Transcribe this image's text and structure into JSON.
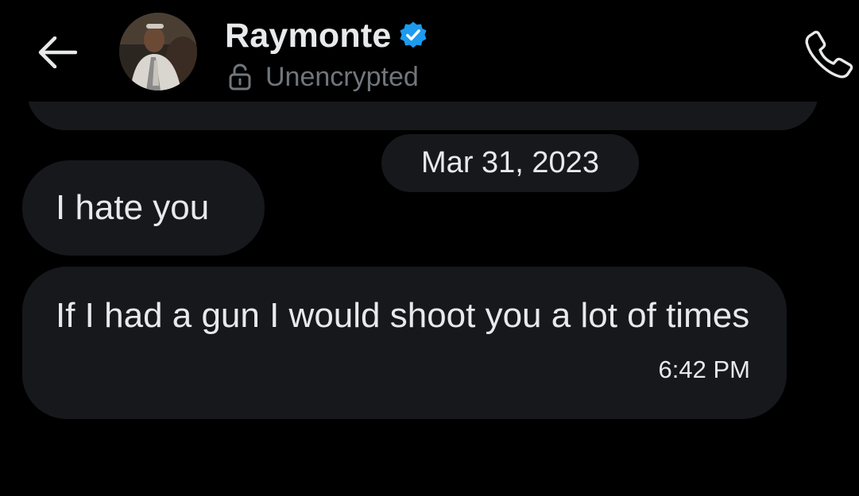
{
  "header": {
    "back_icon": "arrow-left-icon",
    "contact_name": "Raymonte",
    "verified_icon": "verified-badge-icon",
    "lock_icon": "unlocked-padlock-icon",
    "encryption_status": "Unencrypted",
    "call_icon": "phone-icon"
  },
  "conversation": {
    "date_separator": "Mar 31, 2023",
    "messages": [
      {
        "text": "I hate you",
        "time": ""
      },
      {
        "text": "If I had a gun I would shoot you a lot of times",
        "time": "6:42 PM"
      }
    ]
  },
  "colors": {
    "background": "#000000",
    "bubble": "#16181c",
    "text": "#e7e9ea",
    "secondary_text": "#71767b",
    "verified_blue": "#1d9bf0"
  }
}
